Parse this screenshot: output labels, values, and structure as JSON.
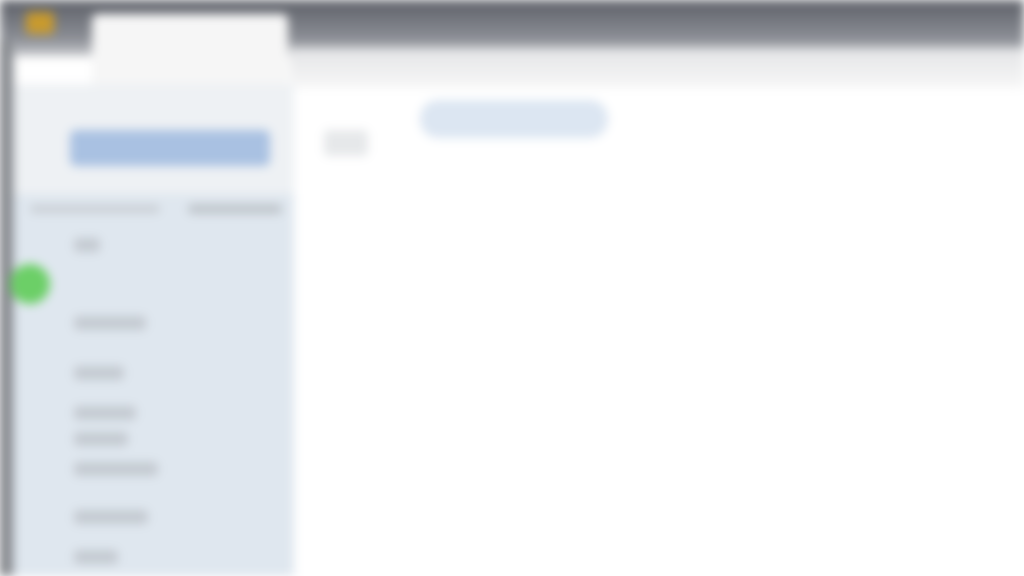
{
  "window": {
    "title": "",
    "tab_label": ""
  },
  "sidebar": {
    "primary_button_label": "",
    "items": [
      {
        "label": ""
      },
      {
        "label": ""
      },
      {
        "label": ""
      },
      {
        "label": ""
      },
      {
        "label": ""
      },
      {
        "label": ""
      },
      {
        "label": ""
      },
      {
        "label": ""
      }
    ]
  },
  "main": {
    "search_placeholder": ""
  },
  "colors": {
    "accent": "#a9c1e2",
    "status_online": "#6ccf67",
    "sidebar_bg": "#dfe7ef",
    "titlebar": "#5d6068"
  },
  "icons": {
    "app": "app-logo-icon",
    "status": "status-dot-icon",
    "back": "back-icon"
  }
}
